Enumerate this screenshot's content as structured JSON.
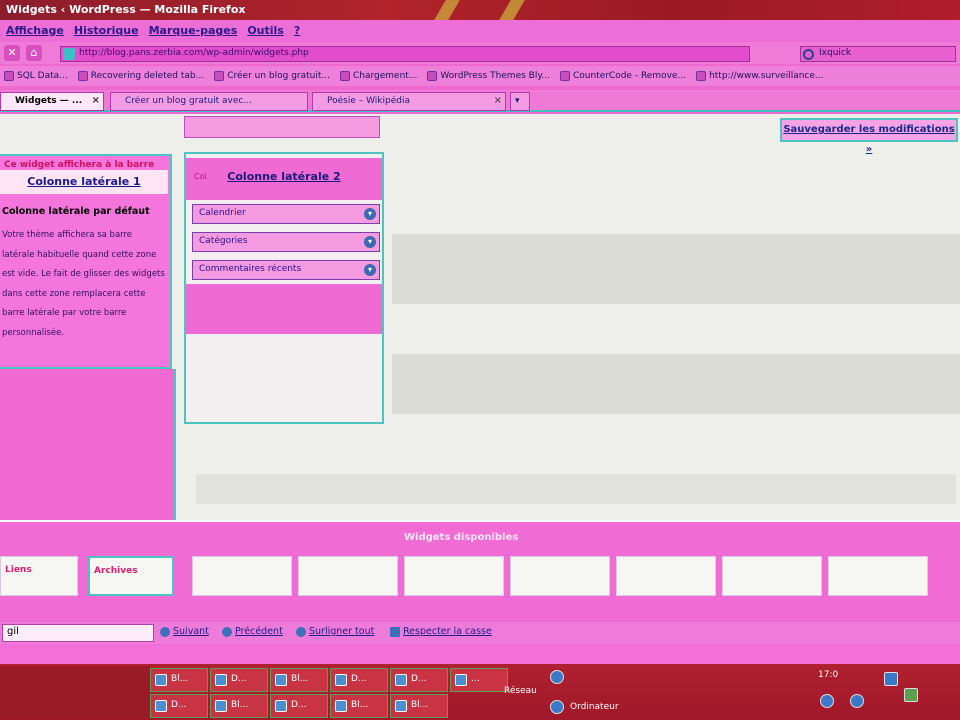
{
  "window": {
    "title": "Widgets ‹ WordPress — Mozilla Firefox"
  },
  "menu": [
    "Affichage",
    "Historique",
    "Marque-pages",
    "Outils",
    "?"
  ],
  "nav": {
    "url": "http://blog.pans.zerbia.com/wp-admin/widgets.php",
    "search": "Ixquick"
  },
  "bookmarks": [
    "SQL Data...",
    "Recovering deleted tab...",
    "Créer un blog gratuit...",
    "Chargement...",
    "WordPress Themes Bly...",
    "CounterCode - Remove...",
    "http://www.surveillance..."
  ],
  "tabs": [
    {
      "label": "Widgets — ..."
    },
    {
      "label": "Créer un blog gratuit avec..."
    },
    {
      "label": "Poésie – Wikipédia"
    }
  ],
  "main": {
    "save_label": "Sauvegarder les modifications »",
    "sidebar1": {
      "top_text": "Ce widget affichera à la barre",
      "heading": "Colonne latérale 1",
      "subheading": "Colonne latérale par défaut",
      "description": "Votre thème affichera sa barre latérale habituelle quand cette zone est vide. Le fait de glisser des widgets dans cette zone remplacera cette barre latérale par votre barre personnalisée."
    },
    "sidebar2": {
      "pre": "Coi",
      "heading": "Colonne latérale 2",
      "widgets": [
        "Calendrier",
        "Catégories",
        "Commentaires récents"
      ]
    },
    "available": {
      "title": "Widgets disponibles",
      "boxes": [
        "Liens",
        "Archives",
        "",
        "",
        "",
        "",
        "",
        "",
        ""
      ]
    }
  },
  "findbar": {
    "value": "gil",
    "next": "Suivant",
    "previous": "Précédent",
    "highlight": "Surligner tout",
    "match_case": "Respecter la casse"
  },
  "taskbar": {
    "buttons": [
      "Bl...",
      "D...",
      "Bl...",
      "D...",
      "D...",
      "...",
      "D...",
      "Bl...",
      "D...",
      "Bl...",
      "Bl..."
    ],
    "tray": {
      "network": "Réseau",
      "computer": "Ordinateur",
      "clock": "17:0"
    }
  }
}
